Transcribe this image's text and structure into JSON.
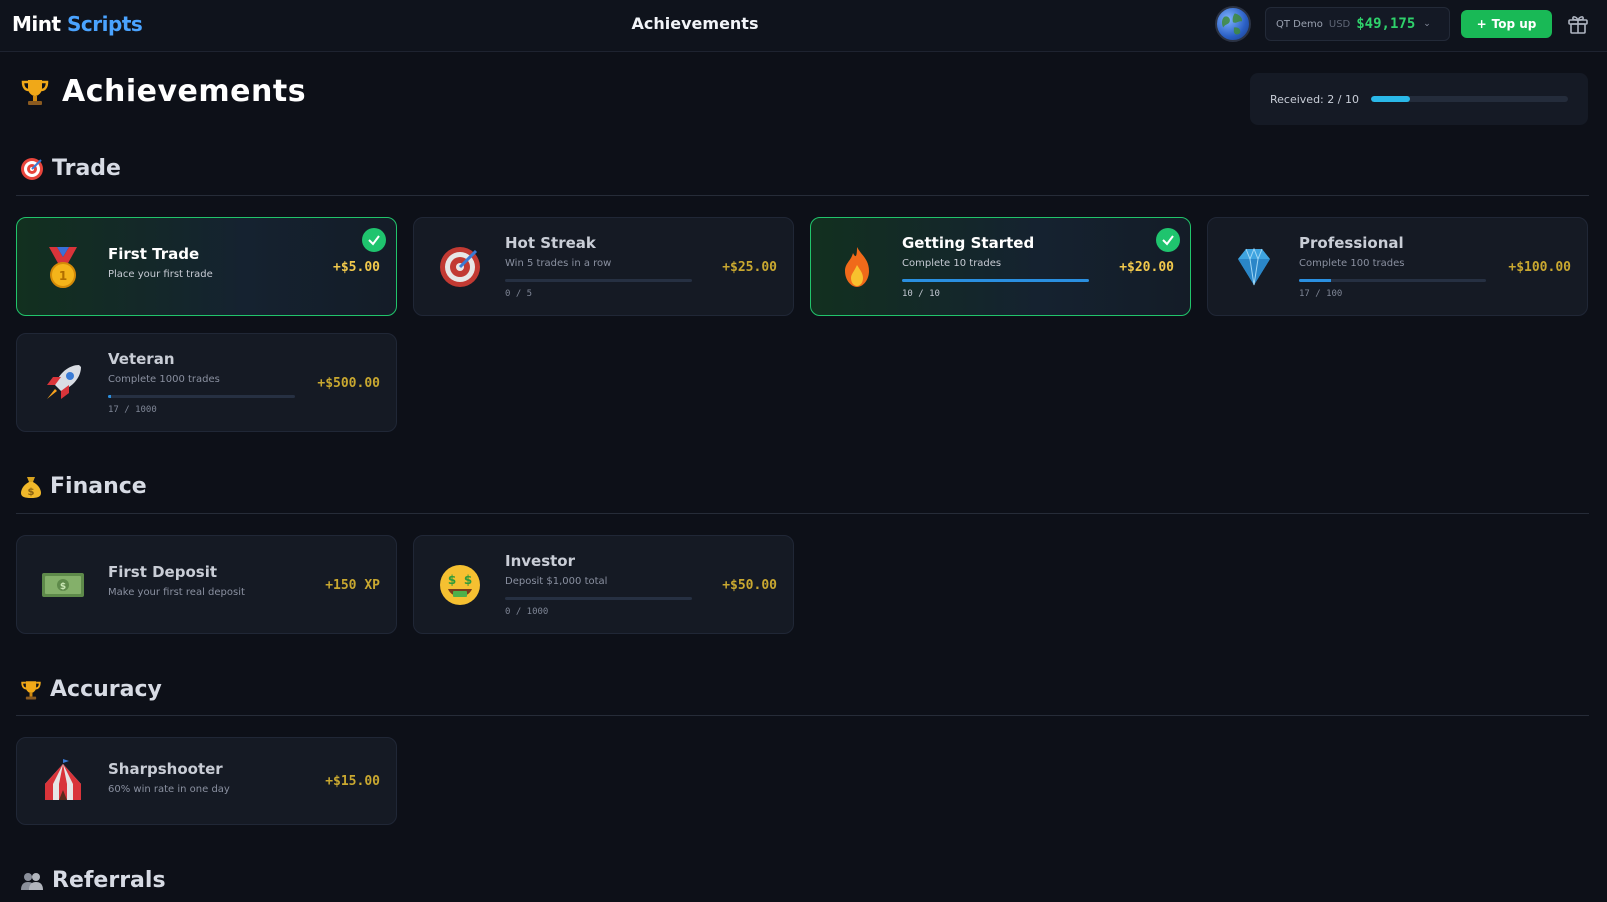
{
  "topbar": {
    "logo_part1": "Mint",
    "logo_part2": "Scripts",
    "title": "Achievements",
    "account_name": "QT Demo",
    "currency": "USD",
    "balance": "$49,175",
    "topup_label": "Top up"
  },
  "page": {
    "title": "Achievements",
    "received_label": "Received: 2 / 10",
    "received_progress": 0.2
  },
  "sections": {
    "trade": "Trade",
    "finance": "Finance",
    "accuracy": "Accuracy",
    "referrals": "Referrals"
  },
  "cards": {
    "first_trade": {
      "title": "First Trade",
      "desc": "Place your first trade",
      "reward": "+$5.00",
      "done": true
    },
    "hot_streak": {
      "title": "Hot Streak",
      "desc": "Win 5 trades in a row",
      "count": "0 / 5",
      "progress": 0,
      "reward": "+$25.00"
    },
    "getting_started": {
      "title": "Getting Started",
      "desc": "Complete 10 trades",
      "count": "10 / 10",
      "progress": 1.0,
      "reward": "+$20.00",
      "done": true
    },
    "professional": {
      "title": "Professional",
      "desc": "Complete 100 trades",
      "count": "17 / 100",
      "progress": 0.17,
      "reward": "+$100.00"
    },
    "veteran": {
      "title": "Veteran",
      "desc": "Complete 1000 trades",
      "count": "17 / 1000",
      "progress": 0.017,
      "reward": "+$500.00"
    },
    "first_deposit": {
      "title": "First Deposit",
      "desc": "Make your first real deposit",
      "reward": "+150 XP"
    },
    "investor": {
      "title": "Investor",
      "desc": "Deposit $1,000 total",
      "count": "0 / 1000",
      "progress": 0,
      "reward": "+$50.00"
    },
    "sharpshooter": {
      "title": "Sharpshooter",
      "desc": "60% win rate in one day",
      "reward": "+$15.00"
    }
  },
  "icons": {
    "trophy": "trophy-icon",
    "target": "target-icon",
    "money_bag": "money-bag-icon",
    "medal": "medal-icon",
    "fire": "fire-icon",
    "diamond": "diamond-icon",
    "rocket": "rocket-icon",
    "banknote": "banknote-icon",
    "money_face": "money-face-icon",
    "circus_tent": "circus-tent-icon",
    "people": "people-icon",
    "globe": "globe-icon",
    "gift": "gift-icon"
  },
  "colors": {
    "accent_green": "#19b956",
    "balance_green": "#2fd16b",
    "reward_gold": "#f2c94c",
    "progress_blue": "#2a8fe0",
    "logo_blue": "#4aa3ff"
  }
}
